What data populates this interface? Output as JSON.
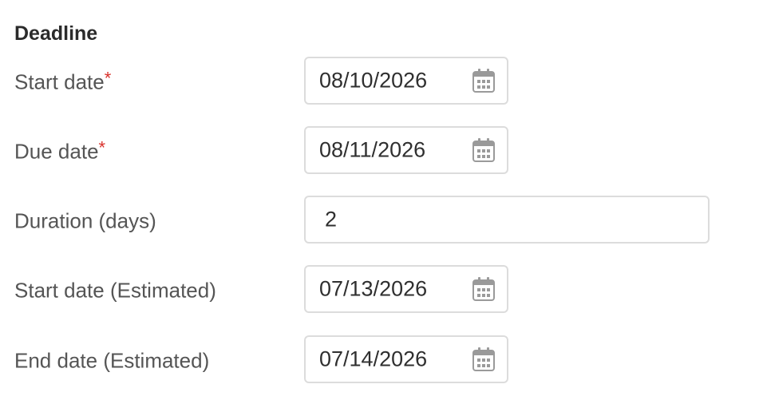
{
  "section": {
    "title": "Deadline"
  },
  "fields": [
    {
      "label": "Start date",
      "required": "*",
      "value": "08/10/2026",
      "icon": "calendar-icon"
    },
    {
      "label": "Due date",
      "required": "*",
      "value": "08/11/2026",
      "icon": "calendar-icon"
    },
    {
      "label": "Duration (days)",
      "value": "2"
    },
    {
      "label": "Start date (Estimated)",
      "value": "07/13/2026",
      "icon": "calendar-icon"
    },
    {
      "label": "End date (Estimated)",
      "value": "07/14/2026",
      "icon": "calendar-icon"
    }
  ],
  "colors": {
    "required": "#d9312b",
    "border": "#dcdcdc",
    "icon": "#9a9a9a"
  }
}
